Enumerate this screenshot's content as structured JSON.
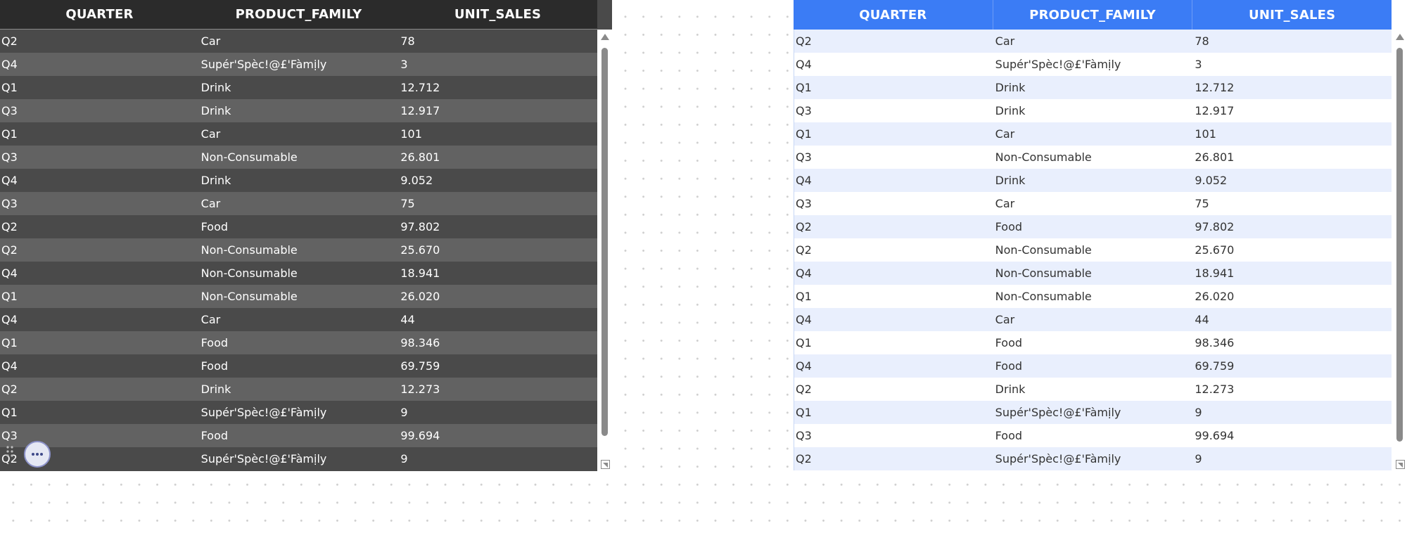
{
  "tables": {
    "dark": {
      "columns": [
        "QUARTER",
        "PRODUCT_FAMILY",
        "UNIT_SALES"
      ],
      "rows": [
        [
          "Q2",
          "Car",
          "78"
        ],
        [
          "Q4",
          "Supér'Spèc!@£'Fàmịly",
          "3"
        ],
        [
          "Q1",
          "Drink",
          "12.712"
        ],
        [
          "Q3",
          "Drink",
          "12.917"
        ],
        [
          "Q1",
          "Car",
          "101"
        ],
        [
          "Q3",
          "Non-Consumable",
          "26.801"
        ],
        [
          "Q4",
          "Drink",
          "9.052"
        ],
        [
          "Q3",
          "Car",
          "75"
        ],
        [
          "Q2",
          "Food",
          "97.802"
        ],
        [
          "Q2",
          "Non-Consumable",
          "25.670"
        ],
        [
          "Q4",
          "Non-Consumable",
          "18.941"
        ],
        [
          "Q1",
          "Non-Consumable",
          "26.020"
        ],
        [
          "Q4",
          "Car",
          "44"
        ],
        [
          "Q1",
          "Food",
          "98.346"
        ],
        [
          "Q4",
          "Food",
          "69.759"
        ],
        [
          "Q2",
          "Drink",
          "12.273"
        ],
        [
          "Q1",
          "Supér'Spèc!@£'Fàmịly",
          "9"
        ],
        [
          "Q3",
          "Food",
          "99.694"
        ],
        [
          "Q2",
          "Supér'Spèc!@£'Fàmịly",
          "9"
        ]
      ]
    },
    "light": {
      "columns": [
        "QUARTER",
        "PRODUCT_FAMILY",
        "UNIT_SALES"
      ],
      "rows": [
        [
          "Q2",
          "Car",
          "78"
        ],
        [
          "Q4",
          "Supér'Spèc!@£'Fàmịly",
          "3"
        ],
        [
          "Q1",
          "Drink",
          "12.712"
        ],
        [
          "Q3",
          "Drink",
          "12.917"
        ],
        [
          "Q1",
          "Car",
          "101"
        ],
        [
          "Q3",
          "Non-Consumable",
          "26.801"
        ],
        [
          "Q4",
          "Drink",
          "9.052"
        ],
        [
          "Q3",
          "Car",
          "75"
        ],
        [
          "Q2",
          "Food",
          "97.802"
        ],
        [
          "Q2",
          "Non-Consumable",
          "25.670"
        ],
        [
          "Q4",
          "Non-Consumable",
          "18.941"
        ],
        [
          "Q1",
          "Non-Consumable",
          "26.020"
        ],
        [
          "Q4",
          "Car",
          "44"
        ],
        [
          "Q1",
          "Food",
          "98.346"
        ],
        [
          "Q4",
          "Food",
          "69.759"
        ],
        [
          "Q2",
          "Drink",
          "12.273"
        ],
        [
          "Q1",
          "Supér'Spèc!@£'Fàmịly",
          "9"
        ],
        [
          "Q3",
          "Food",
          "99.694"
        ],
        [
          "Q2",
          "Supér'Spèc!@£'Fàmịly",
          "9"
        ]
      ]
    }
  },
  "theme": {
    "dark_header_bg": "#2b2b2b",
    "dark_row_a": "#4a4a4a",
    "dark_row_b": "#626262",
    "light_header_bg": "#3b7cf5",
    "light_row_a": "#e9effd",
    "light_row_b": "#ffffff"
  },
  "icons": {
    "scroll_up": "triangle-up-icon",
    "resize": "resize-corner-icon",
    "drag": "drag-handle-icon",
    "more": "more-horizontal-icon"
  }
}
